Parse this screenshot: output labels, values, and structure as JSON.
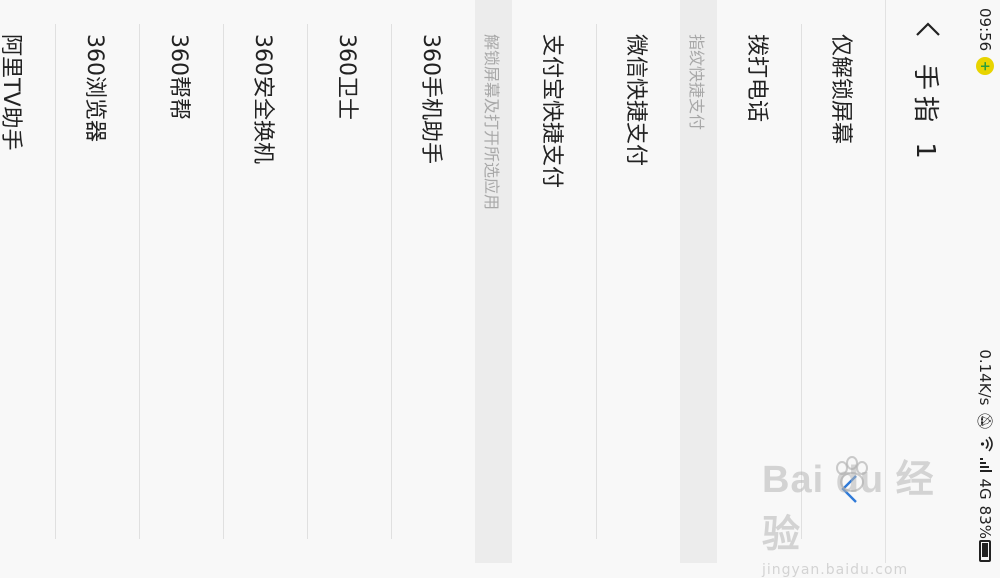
{
  "status_bar": {
    "time": "09:56",
    "net_speed": "0.14K/s",
    "network": "4G",
    "battery": "83%"
  },
  "header": {
    "title": "手指 1"
  },
  "items": [
    {
      "label": "仅解锁屏幕"
    },
    {
      "label": "拨打电话"
    }
  ],
  "section_fingerprint_pay": "指纹快捷支付",
  "pay_items": [
    {
      "label": "微信快捷支付"
    },
    {
      "label": "支付宝快捷支付"
    }
  ],
  "section_unlock_open_app": "解锁屏幕及打开所选应用",
  "app_items": [
    {
      "label": "360手机助手"
    },
    {
      "label": "360卫士"
    },
    {
      "label": "360安全换机"
    },
    {
      "label": "360帮帮"
    },
    {
      "label": "360浏览器"
    },
    {
      "label": "阿里TV助手"
    }
  ],
  "watermark": {
    "main": "Bai du 经验",
    "sub": "jingyan.baidu.com"
  },
  "colors": {
    "background": "#f8f8f8",
    "section_bg": "#ececec",
    "section_text": "#a8a8a8",
    "accent": "#2f7ad8"
  }
}
